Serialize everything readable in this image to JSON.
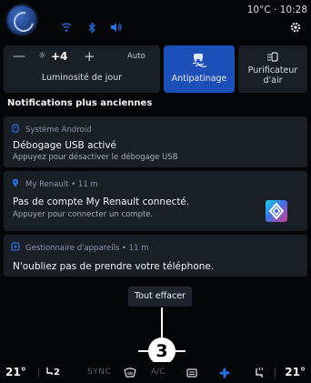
{
  "status": {
    "temperature": "10°C",
    "time": "10:28",
    "separator": "·"
  },
  "quick_settings": {
    "brightness": {
      "minus_label": "—",
      "value": "+4",
      "plus_label": "+",
      "auto_label": "Auto",
      "label": "Luminosité de jour"
    },
    "traction": {
      "label": "Antipatinage",
      "active": true
    },
    "air_purifier": {
      "label": "Purificateur d'air"
    }
  },
  "notifications": {
    "section_title": "Notifications plus anciennes",
    "items": [
      {
        "app": "Système Android",
        "icon": "android-settings-icon",
        "title": "Débogage USB activé",
        "subtitle": "Appuyez pour désactiver le débogage USB"
      },
      {
        "app": "My Renault • 11 m",
        "icon": "location-pin-icon",
        "title": "Pas de compte My Renault connecté.",
        "subtitle": "Appuyer pour connecter un compte."
      },
      {
        "app": "Gestionnaire d'appareils • 11 m",
        "icon": "phone-device-icon",
        "title": "N'oubliez pas de prendre votre téléphone.",
        "subtitle": ""
      }
    ],
    "clear_all_label": "Tout effacer"
  },
  "callout": {
    "number": "3"
  },
  "bottom_bar": {
    "temp_left": "21°",
    "seat_heat_left": "2",
    "sync_label": "SYNC",
    "ac_label": "A/C",
    "temp_right": "21°"
  },
  "colors": {
    "accent": "#1d4fb8",
    "card_bg": "#1a1e25",
    "page_bg": "#050608"
  }
}
